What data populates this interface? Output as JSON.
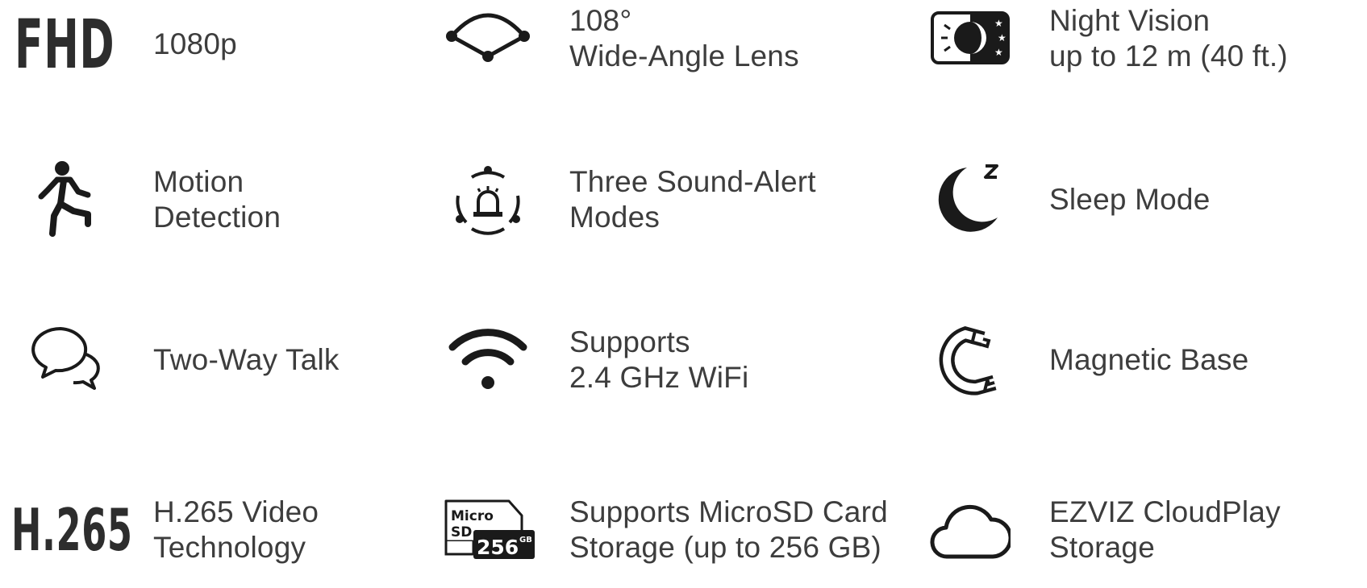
{
  "features": {
    "fhd": {
      "badge": "FHD",
      "lines": [
        "1080p"
      ]
    },
    "wide_angle": {
      "lines": [
        "108°",
        "Wide-Angle Lens"
      ],
      "icon": "wide-angle-lens-icon"
    },
    "night_vision": {
      "lines": [
        "Night Vision",
        "up to 12 m (40 ft.)"
      ],
      "icon": "night-vision-icon"
    },
    "motion": {
      "lines": [
        "Motion",
        "Detection"
      ],
      "icon": "running-person-icon"
    },
    "sound_alert": {
      "lines": [
        "Three Sound-Alert",
        "Modes"
      ],
      "icon": "siren-icon"
    },
    "sleep": {
      "lines": [
        "Sleep Mode"
      ],
      "icon": "moon-sleep-icon"
    },
    "talk": {
      "lines": [
        "Two-Way Talk"
      ],
      "icon": "speech-bubbles-icon"
    },
    "wifi": {
      "lines": [
        "Supports",
        "2.4 GHz WiFi"
      ],
      "icon": "wifi-icon"
    },
    "magnetic": {
      "lines": [
        "Magnetic Base"
      ],
      "icon": "magnet-icon"
    },
    "h265": {
      "badge": "H.265",
      "lines": [
        "H.265 Video",
        "Technology"
      ]
    },
    "microsd": {
      "lines": [
        "Supports MicroSD Card",
        "Storage (up to 256 GB)"
      ],
      "icon": "microsd-card-icon",
      "card": {
        "line1": "Micro",
        "line2": "SD",
        "capacity": "256",
        "unit": "GB"
      }
    },
    "cloud": {
      "lines": [
        "EZVIZ CloudPlay",
        "Storage"
      ],
      "icon": "cloud-icon"
    }
  },
  "colors": {
    "text": "#3d3d3d",
    "icon": "#2d2d2d"
  }
}
